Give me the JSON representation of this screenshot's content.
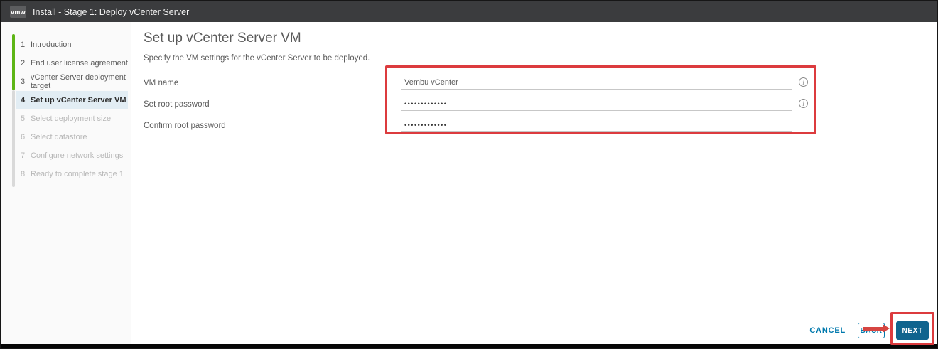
{
  "window": {
    "logo_text": "vmw",
    "title": "Install - Stage 1: Deploy vCenter Server"
  },
  "sidebar": {
    "steps": [
      {
        "num": "1",
        "label": "Introduction",
        "state": "completed"
      },
      {
        "num": "2",
        "label": "End user license agreement",
        "state": "completed"
      },
      {
        "num": "3",
        "label": "vCenter Server deployment target",
        "state": "completed"
      },
      {
        "num": "4",
        "label": "Set up vCenter Server VM",
        "state": "current"
      },
      {
        "num": "5",
        "label": "Select deployment size",
        "state": "pending"
      },
      {
        "num": "6",
        "label": "Select datastore",
        "state": "pending"
      },
      {
        "num": "7",
        "label": "Configure network settings",
        "state": "pending"
      },
      {
        "num": "8",
        "label": "Ready to complete stage 1",
        "state": "pending"
      }
    ]
  },
  "main": {
    "title": "Set up vCenter Server VM",
    "subtitle": "Specify the VM settings for the vCenter Server to be deployed.",
    "fields": [
      {
        "label": "VM name",
        "value": "Vembu vCenter",
        "type": "text",
        "has_info_icon": true
      },
      {
        "label": "Set root password",
        "value": "•••••••••••••",
        "type": "password",
        "has_info_icon": true
      },
      {
        "label": "Confirm root password",
        "value": "•••••••••••••",
        "type": "password",
        "has_info_icon": false
      }
    ]
  },
  "footer": {
    "cancel_label": "CANCEL",
    "back_label": "BACK",
    "next_label": "NEXT"
  },
  "icons": {
    "info_glyph": "i"
  },
  "colors": {
    "header_bg": "#3b3c3e",
    "accent_blue": "#0079ad",
    "primary_button_bg": "#10648e",
    "progress_green": "#5db515",
    "active_step_bg": "#e2edf4",
    "annotation_red": "#dc3b3e"
  }
}
